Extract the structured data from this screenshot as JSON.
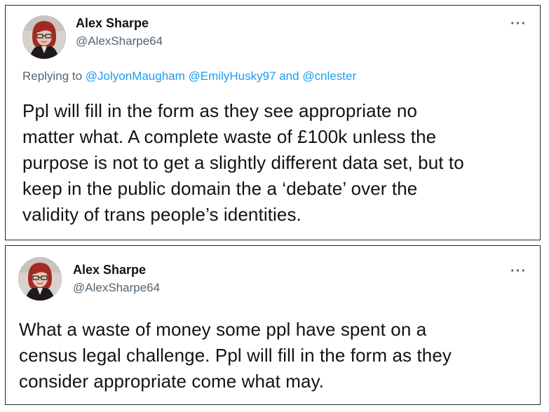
{
  "tweets": [
    {
      "author_name": "Alex Sharpe",
      "author_handle": "@AlexSharpe64",
      "more_icon": "more-horizontal-icon",
      "replying_prefix": "Replying to",
      "replying_to": [
        "@JolyonMaugham",
        "@EmilyHusky97"
      ],
      "replying_and": "and",
      "replying_last": "@cnlester",
      "text_lines": [
        "Ppl will fill in the form as they see appropriate no",
        "matter what. A complete waste of £100k unless the",
        "purpose is not to get a slightly different data set, but to",
        "keep in the public domain the a ‘debate’ over the",
        "validity of trans people’s identities."
      ]
    },
    {
      "author_name": "Alex Sharpe",
      "author_handle": "@AlexSharpe64",
      "more_icon": "more-horizontal-icon",
      "text_lines": [
        "What a waste of money some ppl have spent on a",
        "census legal challenge. Ppl will fill in the form as they",
        "consider appropriate come what may."
      ]
    }
  ],
  "colors": {
    "link": "#1d9bf0",
    "secondary_text": "#536471",
    "primary_text": "#0f1419",
    "border": "#2b2b2b"
  }
}
